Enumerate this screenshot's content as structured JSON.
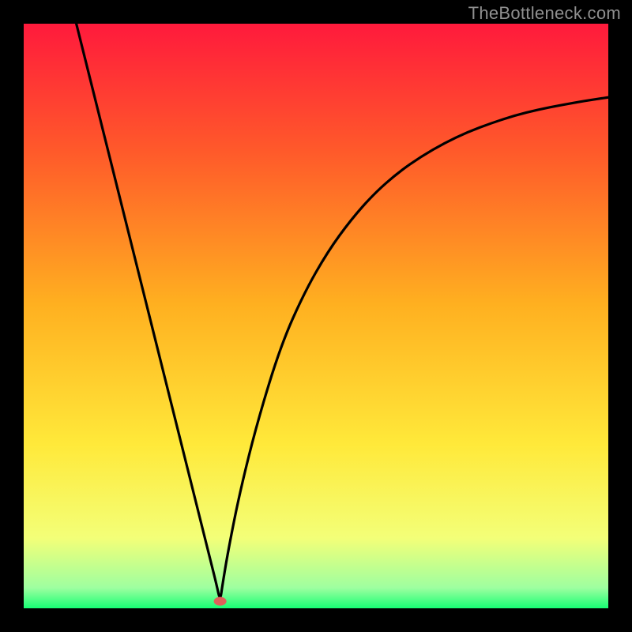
{
  "watermark": "TheBottleneck.com",
  "chart_data": {
    "type": "line",
    "title": "",
    "xlabel": "",
    "ylabel": "",
    "xlim": [
      0,
      100
    ],
    "ylim": [
      0,
      100
    ],
    "grid": false,
    "background_gradient": {
      "top": "#ff1a3c",
      "q1": "#ff5a2a",
      "q2": "#ffb020",
      "q3": "#ffe93a",
      "near_bottom_upper": "#f3ff78",
      "near_bottom_lower": "#9effa0",
      "bottom": "#17ff74"
    },
    "series": [
      {
        "name": "curve",
        "x": [
          9,
          11,
          13,
          15,
          17,
          19,
          21,
          23,
          25,
          27,
          29,
          31,
          32,
          33,
          33.6,
          34,
          35,
          37,
          40,
          44,
          48,
          52,
          56,
          60,
          64,
          68,
          72,
          76,
          80,
          84,
          88,
          92,
          96,
          100
        ],
        "y": [
          100,
          92,
          84,
          76,
          68,
          60,
          52,
          44,
          36,
          28,
          20,
          12,
          8,
          4,
          1.2,
          4,
          10,
          20,
          32,
          45,
          54,
          61,
          66.5,
          71,
          74.5,
          77.3,
          79.6,
          81.5,
          83,
          84.3,
          85.3,
          86.1,
          86.8,
          87.4
        ]
      }
    ],
    "minimum_marker": {
      "x": 33.6,
      "y": 1.2,
      "color": "#e0615a"
    }
  }
}
